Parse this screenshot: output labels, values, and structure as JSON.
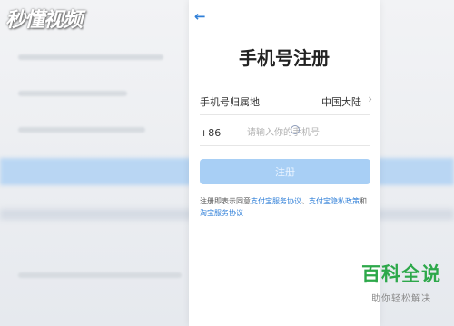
{
  "watermark_top_left": "秒懂视频",
  "header": {
    "back_icon": "back-arrow-icon",
    "title": "手机号注册"
  },
  "region": {
    "label": "手机号归属地",
    "value": "中国大陆",
    "chevron": "›"
  },
  "phone": {
    "prefix": "+86",
    "placeholder": "请输入你的手机号"
  },
  "register_button": {
    "label": "注册"
  },
  "agreement": {
    "prefix": "注册即表示同意",
    "link1": "支付宝服务协议",
    "sep1": "、",
    "link2": "支付宝隐私政策",
    "sep2": "和",
    "link3": "淘宝服务协议"
  },
  "watermark_bottom_right": {
    "title": "百科全说",
    "subtitle": "助你轻松解决"
  },
  "colors": {
    "accent": "#2f7fd8",
    "button_disabled": "#a8cff5",
    "brand_green": "#2da84a"
  }
}
